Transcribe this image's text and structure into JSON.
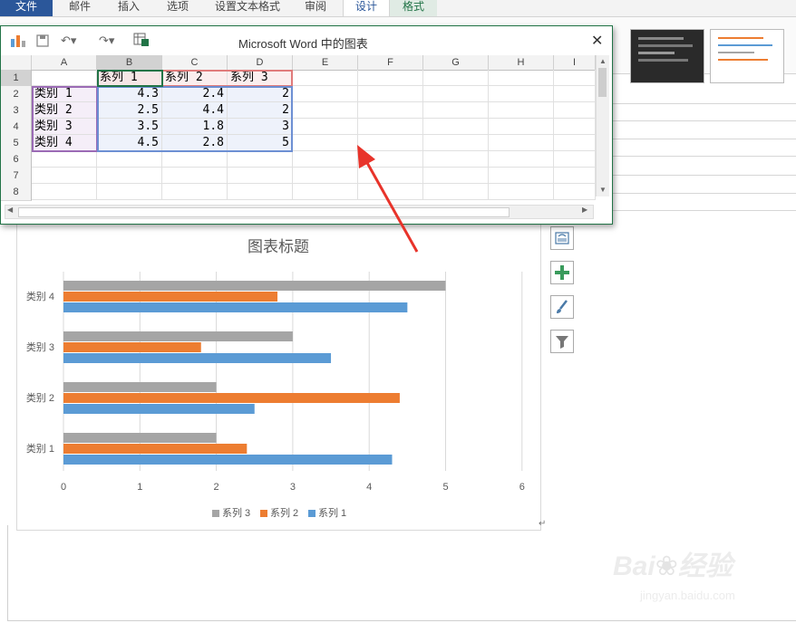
{
  "ribbon": {
    "tabs": [
      "文件",
      "邮件",
      "插入",
      "选项",
      "设置文本格式",
      "审阅",
      "设计",
      "格式"
    ]
  },
  "data_window": {
    "title": "Microsoft Word 中的图表",
    "columns": [
      "A",
      "B",
      "C",
      "D",
      "E",
      "F",
      "G",
      "H",
      "I"
    ],
    "rows": [
      "1",
      "2",
      "3",
      "4",
      "5",
      "6",
      "7",
      "8"
    ],
    "header_row": [
      "系列 1",
      "系列 2",
      "系列 3"
    ],
    "data_rows": [
      {
        "label": "类别 1",
        "values": [
          "4.3",
          "2.4",
          "2"
        ]
      },
      {
        "label": "类别 2",
        "values": [
          "2.5",
          "4.4",
          "2"
        ]
      },
      {
        "label": "类别 3",
        "values": [
          "3.5",
          "1.8",
          "3"
        ]
      },
      {
        "label": "类别 4",
        "values": [
          "4.5",
          "2.8",
          "5"
        ]
      }
    ],
    "close_icon": "close-icon"
  },
  "chart_data": {
    "type": "bar",
    "orientation": "horizontal",
    "title": "图表标题",
    "categories": [
      "类别 1",
      "类别 2",
      "类别 3",
      "类别 4"
    ],
    "series": [
      {
        "name": "系列 1",
        "values": [
          4.3,
          2.5,
          3.5,
          4.5
        ],
        "color": "#5b9bd5"
      },
      {
        "name": "系列 2",
        "values": [
          2.4,
          4.4,
          1.8,
          2.8
        ],
        "color": "#ed7d31"
      },
      {
        "name": "系列 3",
        "values": [
          2,
          2,
          3,
          5
        ],
        "color": "#a5a5a5"
      }
    ],
    "x_ticks": [
      "0",
      "1",
      "2",
      "3",
      "4",
      "5",
      "6"
    ],
    "xlim": [
      0,
      6
    ],
    "grid": true,
    "legend_position": "bottom",
    "legend_order": [
      "系列 3",
      "系列 2",
      "系列 1"
    ]
  },
  "watermark": {
    "brand": "Baidu经验",
    "url": "jingyan.baidu.com"
  },
  "colors": {
    "accent": "#2b579a",
    "excel_green": "#217346",
    "arrow": "#e8332a"
  }
}
